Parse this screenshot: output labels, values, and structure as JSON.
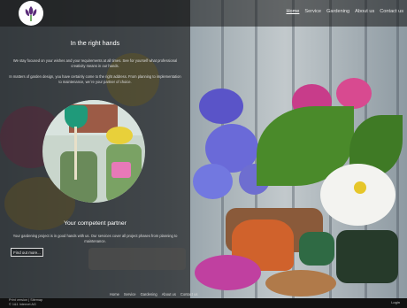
{
  "nav": {
    "items": [
      "Home",
      "Service",
      "Gardening",
      "About us",
      "Contact us"
    ],
    "active": "Home"
  },
  "hero": {
    "title": "In the right hands",
    "text1": "We stay focused on your wishes and your requirements at all times. See for yourself what professional creativity means in our hands.",
    "text2": "In matters of garden design, you have certainly come to the right address. From planning to implementation to maintenance, we´re your partner of choice."
  },
  "partner": {
    "title": "Your competent partner",
    "text": "Your gardening project is in good hands with us. Our services cover all project phases from planning to maintenance.",
    "button": "Find out more..."
  },
  "footer": {
    "nav": [
      "Home",
      "Service",
      "Gardening",
      "About us",
      "Contact us"
    ],
    "print": "Print version",
    "sitemap": "Sitemap",
    "copyright": "© 1&1 Internet AG",
    "login": "Login"
  },
  "colors": {
    "logo_accent": "#5b2d7a",
    "panel": "#121212"
  },
  "icons": {
    "logo": "tulip-logo-icon"
  }
}
